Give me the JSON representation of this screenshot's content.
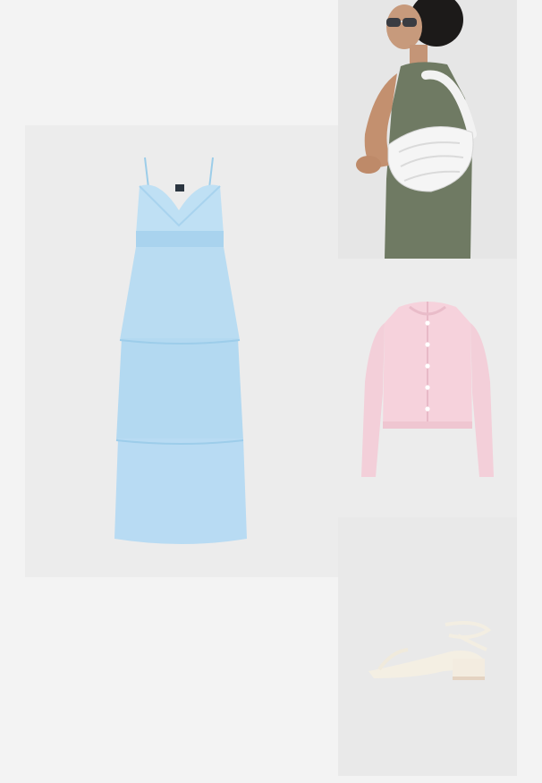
{
  "board": {
    "background": "#f3f3f3"
  },
  "items": [
    {
      "name": "dress-image",
      "icon": "tiered-blue-maxi-dress",
      "color": "#b9dcf2"
    },
    {
      "name": "bag-image",
      "icon": "white-ruched-shoulder-bag",
      "color": "#ffffff"
    },
    {
      "name": "cardigan-image",
      "icon": "pink-knit-cardigan",
      "color": "#f6d2dc"
    },
    {
      "name": "sandal-image",
      "icon": "white-block-heel-sandal",
      "color": "#f4efe3"
    }
  ]
}
